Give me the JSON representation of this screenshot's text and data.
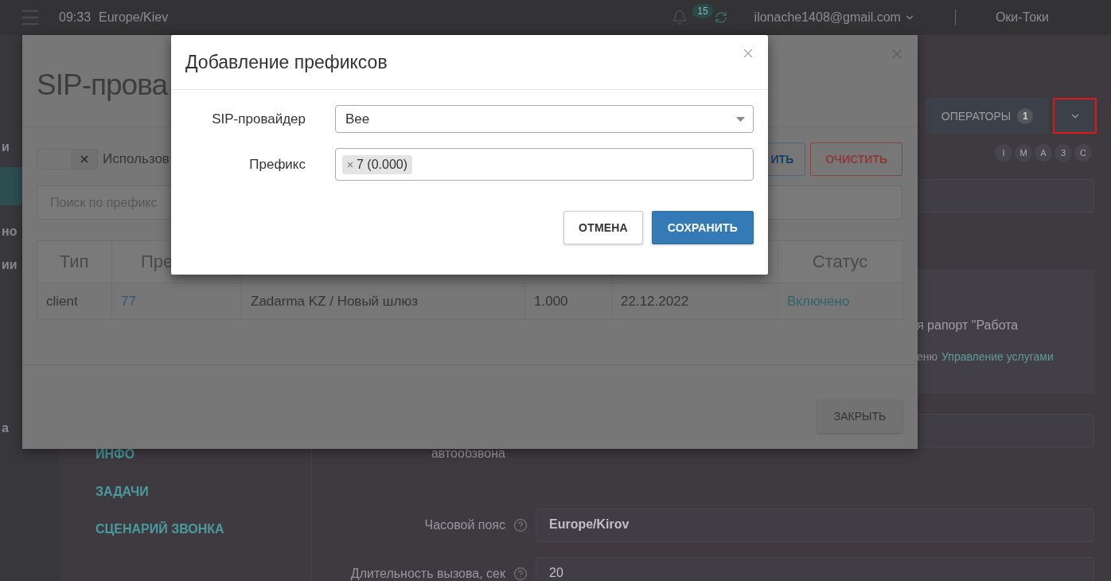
{
  "topbar": {
    "time": "09:33",
    "timezone": "Europe/Kiev",
    "notification_count": "15",
    "account": "ilonache1408@gmail.com",
    "company": "Оки-Токи"
  },
  "sidebar": {
    "items": [
      {
        "label": "и"
      },
      {
        "label": "но"
      },
      {
        "label": "ии"
      },
      {
        "label": "а"
      }
    ]
  },
  "toolbar": {
    "operators_label": "ОПЕРАТОРЫ",
    "operators_count": "1"
  },
  "avatars": [
    "I",
    "M",
    "A",
    "З",
    "C"
  ],
  "notice": {
    "line_1": "я рапорт \"Работа",
    "line_2": "еню",
    "link": "Управление услугами"
  },
  "tabs": [
    {
      "label": "ИНФО"
    },
    {
      "label": "ЗАДАЧИ"
    },
    {
      "label": "СЦЕНАРИЙ ЗВОНКА"
    }
  ],
  "settings": [
    {
      "label": "автообзвона",
      "help": false
    },
    {
      "label": "Часовой пояс",
      "help": true,
      "value": "Europe/Kirov"
    },
    {
      "label": "Длительность вызова, сек",
      "help": true,
      "value": "20"
    }
  ],
  "sip_modal": {
    "title": "SIP-прова",
    "toggle": {
      "label": "Использов",
      "checked": false
    },
    "buttons": [
      {
        "label": "ИТЬ",
        "kind": "primary"
      },
      {
        "label": "ОЧИСТИТЬ",
        "kind": "danger"
      }
    ],
    "search": {
      "placeholder": "Поиск по префикс"
    },
    "table": {
      "columns": [
        {
          "label": "Тип"
        },
        {
          "label": "Пре"
        },
        {},
        {},
        {},
        {
          "label": "Статус"
        }
      ],
      "rows": [
        {
          "cells": [
            {
              "text": "client",
              "kind": "plain"
            },
            {
              "text": "77",
              "kind": "link"
            },
            {
              "text": "Zadarma KZ / Новый шлюз",
              "kind": "plain"
            },
            {
              "text": "1.000",
              "kind": "plain"
            },
            {
              "text": "22.12.2022",
              "kind": "plain"
            },
            {
              "text": "Включено",
              "kind": "status"
            }
          ]
        }
      ]
    },
    "close_button": "ЗАКРЫТЬ"
  },
  "dialog": {
    "title": "Добавление префиксов",
    "fields": [
      {
        "label": "SIP-провайдер",
        "kind": "select",
        "value": "Bee"
      },
      {
        "label": "Префикс",
        "kind": "tags",
        "tags": [
          "7 (0.000)"
        ]
      }
    ],
    "buttons": [
      {
        "label": "ОТМЕНА",
        "kind": "default"
      },
      {
        "label": "СОХРАНИТЬ",
        "kind": "primary"
      }
    ]
  }
}
